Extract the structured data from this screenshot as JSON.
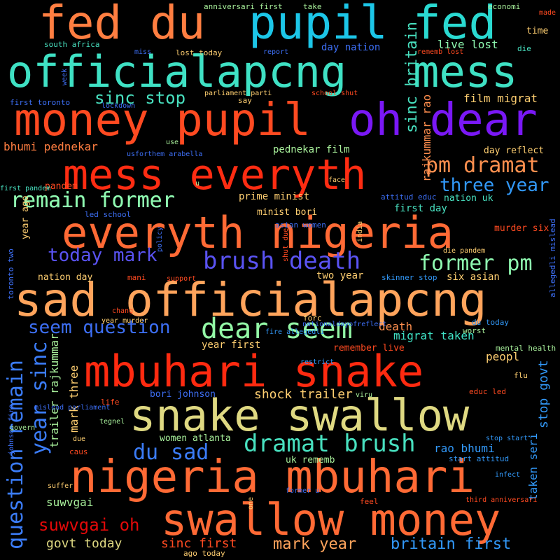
{
  "background": "#000000",
  "words": [
    {
      "text": "fed du",
      "color": "#ff7e41"
    },
    {
      "text": "pupil",
      "color": "#1cc6e8"
    },
    {
      "text": "fed",
      "color": "#2ad9d1"
    },
    {
      "text": "officialapcng",
      "color": "#3fe1c4"
    },
    {
      "text": "mess",
      "color": "#3fe1c4"
    },
    {
      "text": "money pupil",
      "color": "#ff4a21"
    },
    {
      "text": "oh dear",
      "color": "#7a18f6"
    },
    {
      "text": "mess everyth",
      "color": "#fe2c12"
    },
    {
      "text": "pm dramat",
      "color": "#ff904f"
    },
    {
      "text": "remain former",
      "color": "#8ffab1"
    },
    {
      "text": "three year",
      "color": "#3299f9"
    },
    {
      "text": "everyth nigeria",
      "color": "#ff6a35"
    },
    {
      "text": "today mark",
      "color": "#5a53f3"
    },
    {
      "text": "brush death",
      "color": "#5a53f3"
    },
    {
      "text": "former pm",
      "color": "#8ffab1"
    },
    {
      "text": "sad officialapcng",
      "color": "#ffa45c"
    },
    {
      "text": "seem question",
      "color": "#3d6ff5"
    },
    {
      "text": "dear seem",
      "color": "#93f8a6"
    },
    {
      "text": "mbuhari snake",
      "color": "#ff2a10"
    },
    {
      "text": "snake swallow",
      "color": "#dfd982"
    },
    {
      "text": "dramat brush",
      "color": "#48e1c0"
    },
    {
      "text": "du sad",
      "color": "#3b7cf7"
    },
    {
      "text": "nigeria mbuhari",
      "color": "#ff6a35"
    },
    {
      "text": "swallow money",
      "color": "#ff6a35"
    },
    {
      "text": "suwvgai oh",
      "color": "#e40909"
    },
    {
      "text": "question remain",
      "color": "#3b7cf7"
    },
    {
      "text": "year sinc",
      "color": "#3b7cf7"
    },
    {
      "text": "sinc stop",
      "color": "#48e1c0"
    },
    {
      "text": "bhumi pednekar",
      "color": "#ff7e41"
    },
    {
      "text": "film migrat",
      "color": "#ffcf71"
    },
    {
      "text": "sinc britain",
      "color": "#48e1c0"
    },
    {
      "text": "live lost",
      "color": "#8ffab1"
    },
    {
      "text": "day nation",
      "color": "#3d6ff5"
    },
    {
      "text": "rajkummar rao",
      "color": "#ff8e4e"
    },
    {
      "text": "pednekar film",
      "color": "#a8f09b"
    },
    {
      "text": "time",
      "color": "#ffcf71"
    },
    {
      "text": "mark three",
      "color": "#ffcf71"
    },
    {
      "text": "trailer rajkummar",
      "color": "#a8f09b"
    },
    {
      "text": "death",
      "color": "#ff904f"
    },
    {
      "text": "migrat taken",
      "color": "#3fe1c4"
    },
    {
      "text": "shock trailer",
      "color": "#ffcf71"
    },
    {
      "text": "year first",
      "color": "#ffcf71"
    },
    {
      "text": "peopl",
      "color": "#ffcf71"
    },
    {
      "text": "stop govt",
      "color": "#3299f9"
    },
    {
      "text": "rao bhumi",
      "color": "#3299f9"
    },
    {
      "text": "taken seri",
      "color": "#3299f9"
    },
    {
      "text": "britain first",
      "color": "#3299f9"
    },
    {
      "text": "mark year",
      "color": "#ffa45c"
    },
    {
      "text": "sinc first",
      "color": "#ff4a21"
    },
    {
      "text": "govt today",
      "color": "#dfd982"
    },
    {
      "text": "suwvgai",
      "color": "#a8f09b"
    },
    {
      "text": "remain former",
      "color": "#8ffab1"
    },
    {
      "text": "first day",
      "color": "#48e1c0"
    },
    {
      "text": "nation uk",
      "color": "#48e1c0"
    },
    {
      "text": "prime minist",
      "color": "#ffcf71"
    },
    {
      "text": "minist bori",
      "color": "#ffcf71"
    },
    {
      "text": "day reflect",
      "color": "#ffcf71"
    },
    {
      "text": "murder six",
      "color": "#ff4a21"
    },
    {
      "text": "two year",
      "color": "#ffcf71"
    },
    {
      "text": "six asian",
      "color": "#ffcf71"
    },
    {
      "text": "nation day",
      "color": "#ffcf71"
    },
    {
      "text": "year ago",
      "color": "#ffcf71"
    },
    {
      "text": "remember live",
      "color": "#ff4a21"
    },
    {
      "text": "bori johnson",
      "color": "#3d6ff5"
    },
    {
      "text": "women atlanta",
      "color": "#a8f09b"
    },
    {
      "text": "uk rememb",
      "color": "#a8f09b"
    },
    {
      "text": "pandem",
      "color": "#ff4a21"
    },
    {
      "text": "economi",
      "color": "#a8f09b"
    },
    {
      "text": "anniversari first",
      "color": "#a8f09b"
    },
    {
      "text": "take",
      "color": "#a8f09b"
    },
    {
      "text": "made",
      "color": "#ff4a21"
    },
    {
      "text": "south africa",
      "color": "#48e1c0"
    },
    {
      "text": "miss",
      "color": "#3d6ff5"
    },
    {
      "text": "lost today",
      "color": "#ffcf71"
    },
    {
      "text": "report",
      "color": "#3d6ff5"
    },
    {
      "text": "rememb lost",
      "color": "#ff4a21"
    },
    {
      "text": "die",
      "color": "#48e1c0"
    },
    {
      "text": "week",
      "color": "#3d6ff5"
    },
    {
      "text": "parliament parti",
      "color": "#ffcf71"
    },
    {
      "text": "school shut",
      "color": "#ff4a21"
    },
    {
      "text": "say",
      "color": "#ffcf71"
    },
    {
      "text": "first toronto",
      "color": "#3d6ff5"
    },
    {
      "text": "lockdown",
      "color": "#3d6ff5"
    },
    {
      "text": "use",
      "color": "#a8f09b"
    },
    {
      "text": "usforthem arabella",
      "color": "#3d6ff5"
    },
    {
      "text": "face",
      "color": "#ffcf71"
    },
    {
      "text": "u",
      "color": "#a8f09b"
    },
    {
      "text": "first pandem",
      "color": "#48e1c0"
    },
    {
      "text": "led school",
      "color": "#3d6ff5"
    },
    {
      "text": "asian women",
      "color": "#3d6ff5"
    },
    {
      "text": "attitud educ",
      "color": "#3d6ff5"
    },
    {
      "text": "policy",
      "color": "#3d6ff5"
    },
    {
      "text": "shut due",
      "color": "#ff4a21"
    },
    {
      "text": "india",
      "color": "#ffcf71"
    },
    {
      "text": "die pandem",
      "color": "#ffcf71"
    },
    {
      "text": "allegedli mislead",
      "color": "#3d6ff5"
    },
    {
      "text": "toronto two",
      "color": "#3d6ff5"
    },
    {
      "text": "mani",
      "color": "#ff4a21"
    },
    {
      "text": "support",
      "color": "#ff4a21"
    },
    {
      "text": "skinner stop",
      "color": "#3299f9"
    },
    {
      "text": "chang",
      "color": "#ff4a21"
    },
    {
      "text": "forc",
      "color": "#ffcf71"
    },
    {
      "text": "du today",
      "color": "#3299f9"
    },
    {
      "text": "year murder",
      "color": "#ffcf71"
    },
    {
      "text": "nationaldayofreflect",
      "color": "#3d6ff5"
    },
    {
      "text": "worst",
      "color": "#a8f09b"
    },
    {
      "text": "fire allegedli",
      "color": "#3299f9"
    },
    {
      "text": "mental health",
      "color": "#a8f09b"
    },
    {
      "text": "flu",
      "color": "#ffcf71"
    },
    {
      "text": "restrict",
      "color": "#3299f9"
    },
    {
      "text": "viru",
      "color": "#a8f09b"
    },
    {
      "text": "educ led",
      "color": "#ff4a21"
    },
    {
      "text": "johnson fire",
      "color": "#3d6ff5"
    },
    {
      "text": "mislead parliament",
      "color": "#3d6ff5"
    },
    {
      "text": "life",
      "color": "#ff4a21"
    },
    {
      "text": "govern",
      "color": "#a8f09b"
    },
    {
      "text": "tegnel",
      "color": "#a8f09b"
    },
    {
      "text": "due",
      "color": "#ffcf71"
    },
    {
      "text": "stop start",
      "color": "#3299f9"
    },
    {
      "text": "caus",
      "color": "#ff4a21"
    },
    {
      "text": "start attitud",
      "color": "#3299f9"
    },
    {
      "text": "suffer",
      "color": "#ffcf71"
    },
    {
      "text": "former u",
      "color": "#3d6ff5"
    },
    {
      "text": "infect",
      "color": "#3299f9"
    },
    {
      "text": "one",
      "color": "#ffcf71"
    },
    {
      "text": "feel",
      "color": "#ff4a21"
    },
    {
      "text": "third anniversari",
      "color": "#ff4a21"
    },
    {
      "text": "ago today",
      "color": "#ffcf71"
    },
    {
      "text": "arabella skinner",
      "color": "#48e1c0"
    }
  ]
}
